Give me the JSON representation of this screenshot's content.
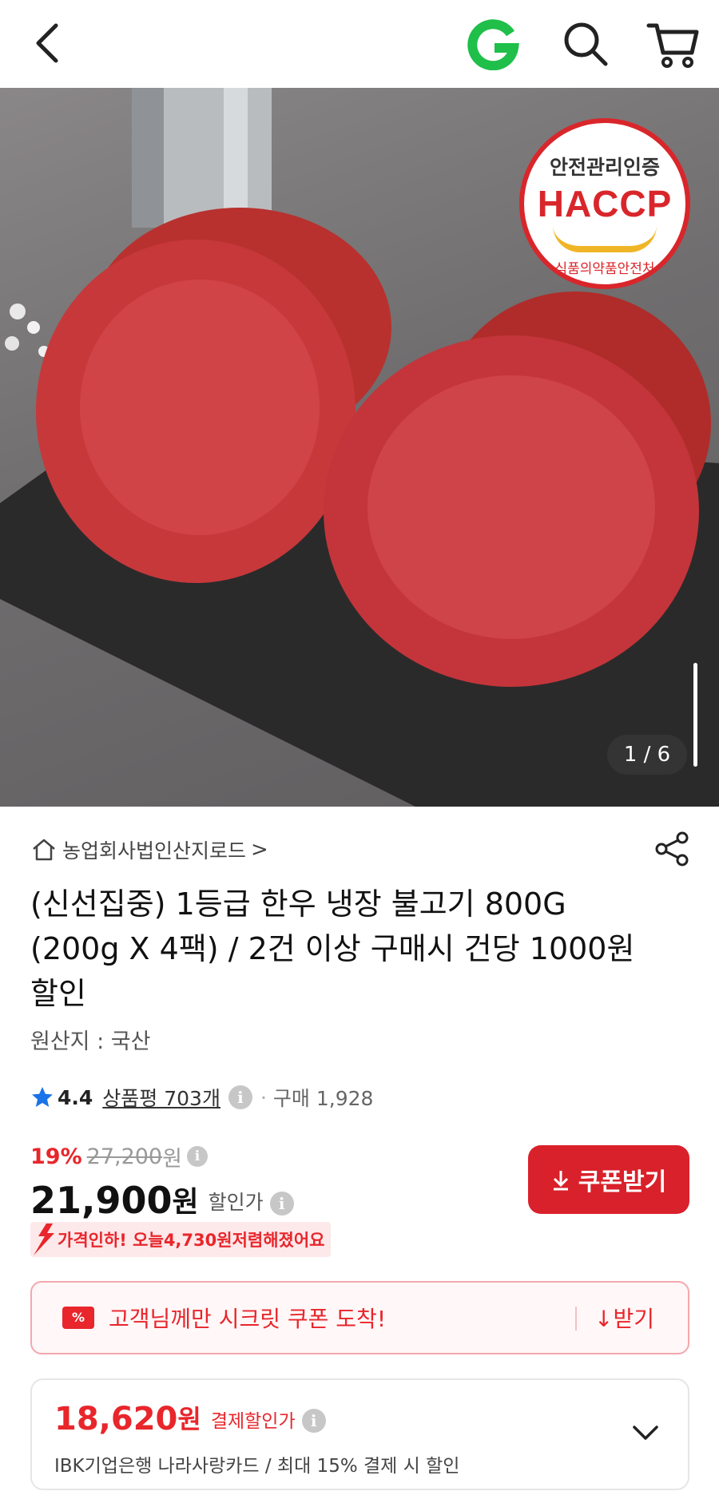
{
  "header": {
    "back_icon": "chevron-left-icon",
    "brand_icon": "gmarket-g-logo",
    "search_icon": "search-icon",
    "cart_icon": "cart-icon"
  },
  "hero": {
    "badge": {
      "line1": "안전관리인증",
      "line2": "HACCP",
      "line3": "식품의약품안전처"
    },
    "counter": "1 / 6"
  },
  "product": {
    "seller": "농업회사법인산지로드",
    "seller_chevron": ">",
    "title": "(신선집중) 1등급 한우 냉장 불고기 800G (200g X 4팩) / 2건 이상 구매시 건당 1000원 할인",
    "origin": "원산지 : 국산",
    "rating": "4.4",
    "reviews": "상품평 703개",
    "dot": "·",
    "sold": "구매 1,928"
  },
  "price": {
    "discount_rate": "19%",
    "original_price": "27,200",
    "original_unit": "원",
    "sale_price": "21,900",
    "sale_unit": "원",
    "sale_label": "할인가",
    "info": "i"
  },
  "coupon_button": {
    "icon": "download-icon",
    "label": "쿠폰받기",
    "color": "#d9212b"
  },
  "price_drop": {
    "prefix": "가격인하! 오늘 ",
    "amount": "4,730원",
    "suffix": " 저렴해졌어요"
  },
  "secret_coupon": {
    "badge": "%",
    "text": "고객님께만 시크릿 쿠폰 도착!",
    "receive": "↓받기"
  },
  "payment_discount": {
    "price": "18,620",
    "unit": "원",
    "label": "결제할인가",
    "card_text": "IBK기업은행 나라사랑카드 / 최대 15% 결제 시 할인"
  },
  "colors": {
    "accent_red": "#e8262b",
    "star_blue": "#1a73e8",
    "g_green": "#1fbf4a"
  }
}
